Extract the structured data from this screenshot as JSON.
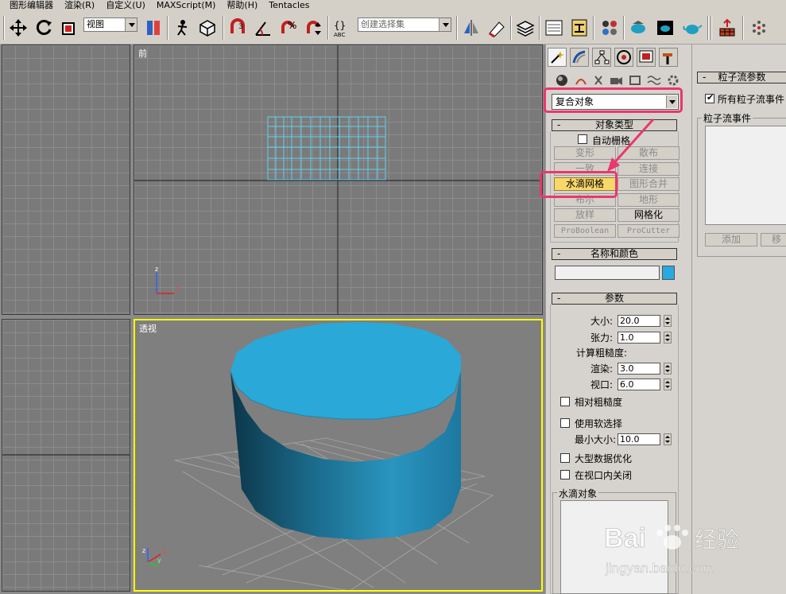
{
  "menu": [
    "图形编辑器",
    "渲染(R)",
    "自定义(U)",
    "MAXScript(M)",
    "帮助(H)",
    "Tentacles"
  ],
  "toolbar": {
    "view_select": "视图",
    "selection_set_placeholder": "创建选择集",
    "icons": [
      "move-icon",
      "rotate-icon",
      "scale-icon",
      "mirror-icon",
      "align-icon",
      "snap-icon",
      "angle-snap-icon",
      "percent-snap-icon",
      "spinner-snap-icon",
      "named-selection-icon",
      "layer-icon",
      "curve-editor-icon",
      "schematic-icon",
      "material-editor-icon",
      "render-setup-icon",
      "render-frame-icon",
      "render-icon",
      "teapot-icon",
      "hierarchy-icon",
      "particle-icon"
    ]
  },
  "viewports": {
    "front_label": "前",
    "perspective_label": "透视",
    "object_color": "#2aa8e0",
    "active_border": "#ffff00"
  },
  "command_panel": {
    "category_dropdown": "复合对象",
    "object_type": {
      "header": "对象类型",
      "autogrid": "自动栅格",
      "autogrid_checked": false,
      "buttons": [
        {
          "label": "变形",
          "enabled": false
        },
        {
          "label": "散布",
          "enabled": false
        },
        {
          "label": "一致",
          "enabled": false
        },
        {
          "label": "连接",
          "enabled": false
        },
        {
          "label": "水滴网格",
          "enabled": true,
          "active": true
        },
        {
          "label": "图形合并",
          "enabled": false
        },
        {
          "label": "布尔",
          "enabled": false
        },
        {
          "label": "地形",
          "enabled": false
        },
        {
          "label": "放样",
          "enabled": false
        },
        {
          "label": "网格化",
          "enabled": true
        },
        {
          "label": "ProBoolean",
          "enabled": false
        },
        {
          "label": "ProCutter",
          "enabled": false
        }
      ]
    },
    "name_color": {
      "header": "名称和颜色",
      "name_value": "",
      "color": "#2aa8e0"
    },
    "parameters": {
      "header": "参数",
      "size_label": "大小:",
      "size_value": "20.0",
      "tension_label": "张力:",
      "tension_value": "1.0",
      "roughness_label": "计算粗糙度:",
      "render_label": "渲染:",
      "render_value": "3.0",
      "viewport_label": "视口:",
      "viewport_value": "6.0",
      "relative_roughness": "相对粗糙度",
      "use_soft_selection": "使用软选择",
      "min_size_label": "最小大小:",
      "min_size_value": "10.0",
      "large_data_opt": "大型数据优化",
      "off_in_viewport": "在视口内关闭",
      "blob_objects": "水滴对象"
    }
  },
  "particle_flow": {
    "header": "粒子流参数",
    "all_events": "所有粒子流事件",
    "all_events_checked": true,
    "events_group": "粒子流事件",
    "add_button": "添加",
    "remove_button": "移"
  },
  "watermark": {
    "brand": "Bai",
    "brand_cn": "经验",
    "url": "jingyan.baidu.com"
  }
}
